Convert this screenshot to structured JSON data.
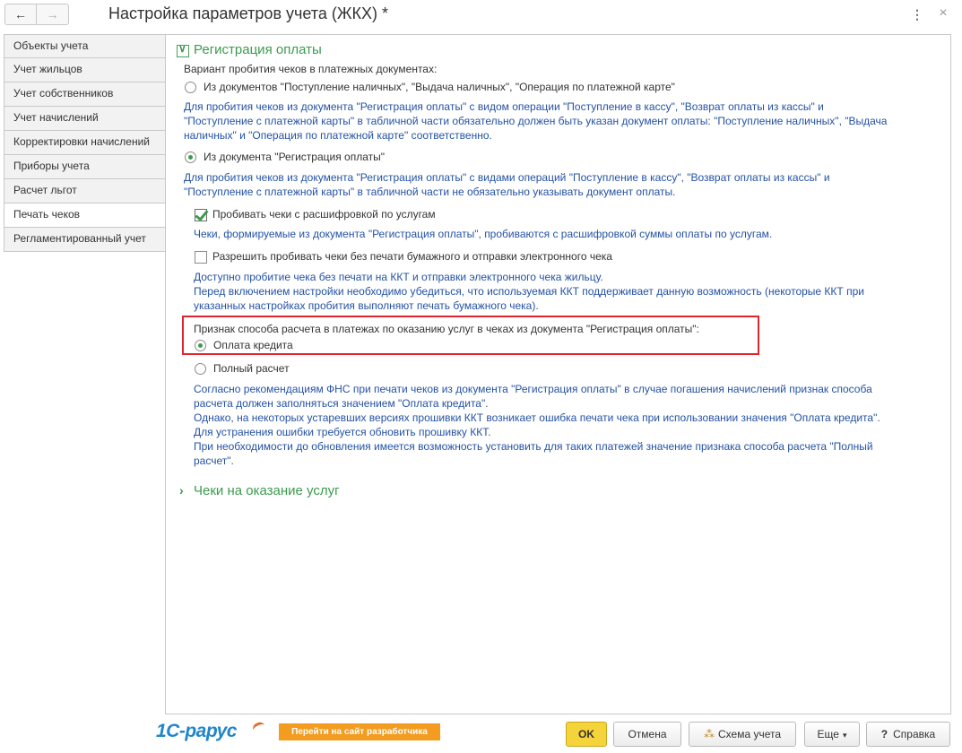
{
  "window": {
    "title": "Настройка параметров учета (ЖКХ) *",
    "back_glyph": "←",
    "forward_glyph": "→",
    "more_glyph": "⋮",
    "close_glyph": "×"
  },
  "sections": [
    {
      "label": "Объекты учета",
      "active": false
    },
    {
      "label": "Учет жильцов",
      "active": false
    },
    {
      "label": "Учет собственников",
      "active": false
    },
    {
      "label": "Учет начислений",
      "active": false
    },
    {
      "label": "Корректировки начислений",
      "active": false
    },
    {
      "label": "Приборы учета",
      "active": false
    },
    {
      "label": "Расчет льгот",
      "active": false
    },
    {
      "label": "Печать чеков",
      "active": true
    },
    {
      "label": "Регламентированный учет",
      "active": false
    }
  ],
  "group1": {
    "title": "Регистрация оплаты",
    "expanded": true,
    "variant_label": "Вариант пробития чеков в платежных документах:",
    "option1": {
      "label": "Из документов \"Поступление наличных\", \"Выдача наличных\", \"Операция по платежной карте\"",
      "selected": false,
      "hint": [
        "Для пробития чеков из документа \"Регистрация оплаты\" с видом операции \"Поступление в кассу\", \"Возврат оплаты из кассы\" и",
        "\"Поступление с платежной карты\" в табличной части обязательно должен быть указан документ оплаты: \"Поступление наличных\", \"Выдача",
        "наличных\" и \"Операция по платежной карте\" соответственно."
      ]
    },
    "option2": {
      "label": "Из документа \"Регистрация оплаты\"",
      "selected": true,
      "hint": [
        "Для пробития чеков из документа \"Регистрация оплаты\" с видами операций \"Поступление в кассу\", \"Возврат оплаты из кассы\" и",
        "\"Поступление с платежной карты\" в табличной части не обязательно указывать документ оплаты."
      ]
    },
    "checkbox1": {
      "label": "Пробивать чеки с расшифровкой по услугам",
      "checked": true,
      "hint": [
        "Чеки, формируемые из документа \"Регистрация оплаты\", пробиваются с расшифровкой суммы оплаты по услугам."
      ]
    },
    "checkbox2": {
      "label": "Разрешить пробивать чеки без печати бумажного и отправки электронного чека",
      "checked": false,
      "hint": [
        "Доступно пробитие чека без печати на ККТ и отправки электронного чека жильцу.",
        "Перед включением настройки необходимо убедиться, что используемая ККТ поддерживает данную возможность (некоторые ККТ при",
        "указанных настройках пробития выполняют печать бумажного чека)."
      ]
    },
    "payment_method": {
      "label": "Признак способа расчета в платежах по оказанию услуг в чеках из документа \"Регистрация оплаты\":",
      "opt_credit": "Оплата кредита",
      "opt_credit_selected": true,
      "opt_full": "Полный расчет",
      "opt_full_selected": false,
      "hint": [
        "Согласно рекомендациям ФНС при печати чеков из документа \"Регистрация оплаты\" в случае погашения начислений признак способа",
        "расчета должен заполняться значением \"Оплата кредита\".",
        "Однако, на некоторых устаревших версиях прошивки ККТ возникает ошибка печати чека при использовании значения \"Оплата кредита\".",
        "Для устранения ошибки требуется обновить прошивку ККТ.",
        "При необходимости до обновления имеется возможность установить для таких платежей значение признака способа расчета \"Полный",
        "расчет\"."
      ]
    }
  },
  "group2": {
    "title": "Чеки на оказание услуг",
    "expanded": false
  },
  "footer": {
    "logo_text": "1C-рарус",
    "dev_site_label": "Перейти на сайт разработчика",
    "ok_label": "OK",
    "cancel_label": "Отмена",
    "scheme_label": "Схема учета",
    "more_label": "Еще",
    "help_label": "Справка",
    "help_glyph": "?",
    "caret_glyph": "▾",
    "scheme_glyph": "⁂"
  },
  "colors": {
    "accent_green": "#3c9b4e",
    "hint_blue": "#2452a4",
    "highlight_red": "#e0262c",
    "ok_yellow": "#f5d33a",
    "dev_orange": "#f39c1f",
    "logo_blue": "#1e86c9"
  }
}
